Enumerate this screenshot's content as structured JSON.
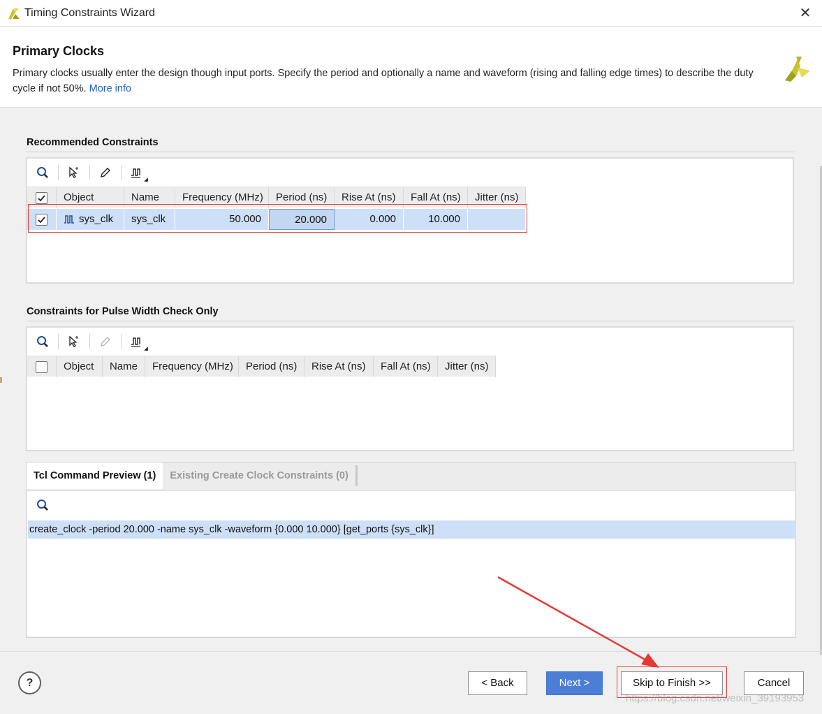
{
  "window": {
    "title": "Timing Constraints Wizard",
    "close_glyph": "✕"
  },
  "header": {
    "title": "Primary Clocks",
    "description": "Primary clocks usually enter the design though input ports. Specify the period and optionally a name and waveform (rising and falling edge times) to describe the duty cycle if not 50%.",
    "link": "More info"
  },
  "recommended": {
    "title": "Recommended Constraints",
    "columns": [
      "Object",
      "Name",
      "Frequency (MHz)",
      "Period (ns)",
      "Rise At (ns)",
      "Fall At (ns)",
      "Jitter (ns)"
    ],
    "rows": [
      {
        "checked": true,
        "object": "sys_clk",
        "name": "sys_clk",
        "frequency": "50.000",
        "period": "20.000",
        "rise_at": "0.000",
        "fall_at": "10.000",
        "jitter": ""
      }
    ]
  },
  "pulse_width": {
    "title": "Constraints for Pulse Width Check Only",
    "columns": [
      "Object",
      "Name",
      "Frequency (MHz)",
      "Period (ns)",
      "Rise At (ns)",
      "Fall At (ns)",
      "Jitter (ns)"
    ]
  },
  "tabs": {
    "items": [
      "Tcl Command Preview (1)",
      "Existing Create Clock Constraints (0)"
    ],
    "active": 0,
    "commands": [
      "create_clock -period 20.000 -name sys_clk -waveform {0.000 10.000} [get_ports {sys_clk}]"
    ]
  },
  "footer": {
    "help": "?",
    "back": "< Back",
    "next": "Next >",
    "skip": "Skip to Finish >>",
    "cancel": "Cancel"
  },
  "watermark": "https://blog.csdn.net/weixin_39193953",
  "colors": {
    "accent": "#4d7ed7",
    "selection": "#cde0f7",
    "highlight": "#e23c3c",
    "brand": "#c7c52a"
  },
  "icons": [
    "vivado-logo-icon",
    "close-icon",
    "search-icon",
    "select-cursor-icon",
    "edit-pencil-icon",
    "clock-wave-icon",
    "checkbox-checked-icon",
    "help-icon",
    "red-arrow-annotation"
  ]
}
